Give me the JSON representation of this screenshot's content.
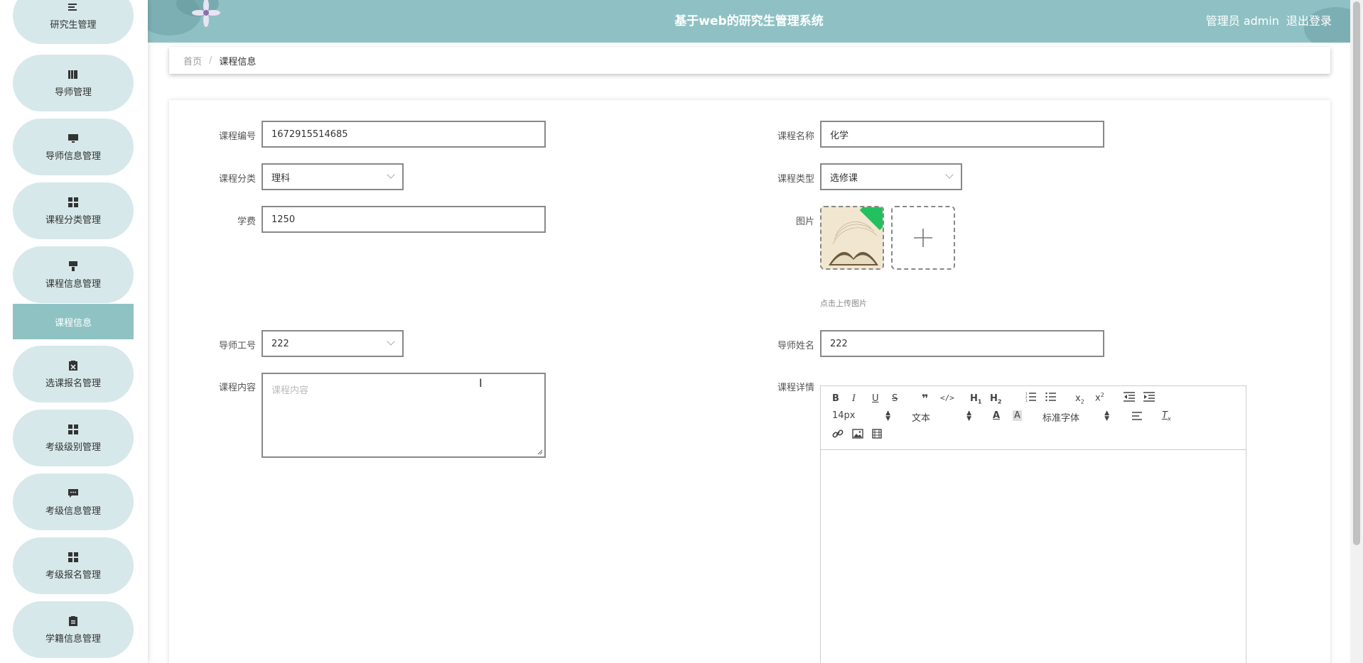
{
  "header": {
    "title": "基于web的研究生管理系统",
    "user_label": "管理员 admin",
    "logout_label": "退出登录"
  },
  "sidebar": {
    "items": [
      {
        "label": "研究生管理",
        "icon": "menu-lines-icon"
      },
      {
        "label": "导师管理",
        "icon": "books-icon"
      },
      {
        "label": "导师信息管理",
        "icon": "monitor-icon"
      },
      {
        "label": "课程分类管理",
        "icon": "grid-icon"
      },
      {
        "label": "课程信息管理",
        "icon": "brush-icon"
      },
      {
        "label": "选课报名管理",
        "icon": "clipboard-x-icon"
      },
      {
        "label": "考级级别管理",
        "icon": "grid-icon"
      },
      {
        "label": "考级信息管理",
        "icon": "chat-icon"
      },
      {
        "label": "考级报名管理",
        "icon": "grid-icon"
      },
      {
        "label": "学籍信息管理",
        "icon": "clipboard-icon"
      }
    ],
    "active_sub": "课程信息"
  },
  "breadcrumb": {
    "home": "首页",
    "separator": "/",
    "current": "课程信息"
  },
  "form": {
    "course_no": {
      "label": "课程编号",
      "value": "1672915514685"
    },
    "course_name": {
      "label": "课程名称",
      "value": "化学"
    },
    "course_category": {
      "label": "课程分类",
      "value": "理科"
    },
    "course_type": {
      "label": "课程类型",
      "value": "选修课"
    },
    "tuition": {
      "label": "学费",
      "value": "1250"
    },
    "image": {
      "label": "图片",
      "hint": "点击上传图片"
    },
    "tutor_id": {
      "label": "导师工号",
      "value": "222"
    },
    "tutor_name": {
      "label": "导师姓名",
      "value": "222"
    },
    "course_content": {
      "label": "课程内容",
      "placeholder": "课程内容"
    },
    "course_detail": {
      "label": "课程详情"
    }
  },
  "editor": {
    "font_size": "14px",
    "text_style": "文本",
    "font_family": "标准字体"
  },
  "colors": {
    "header_bg": "#8fc1c4",
    "menu_bg": "#d6e8ea",
    "active_sub_bg": "#8fc3c3",
    "badge_green": "#23c060"
  }
}
